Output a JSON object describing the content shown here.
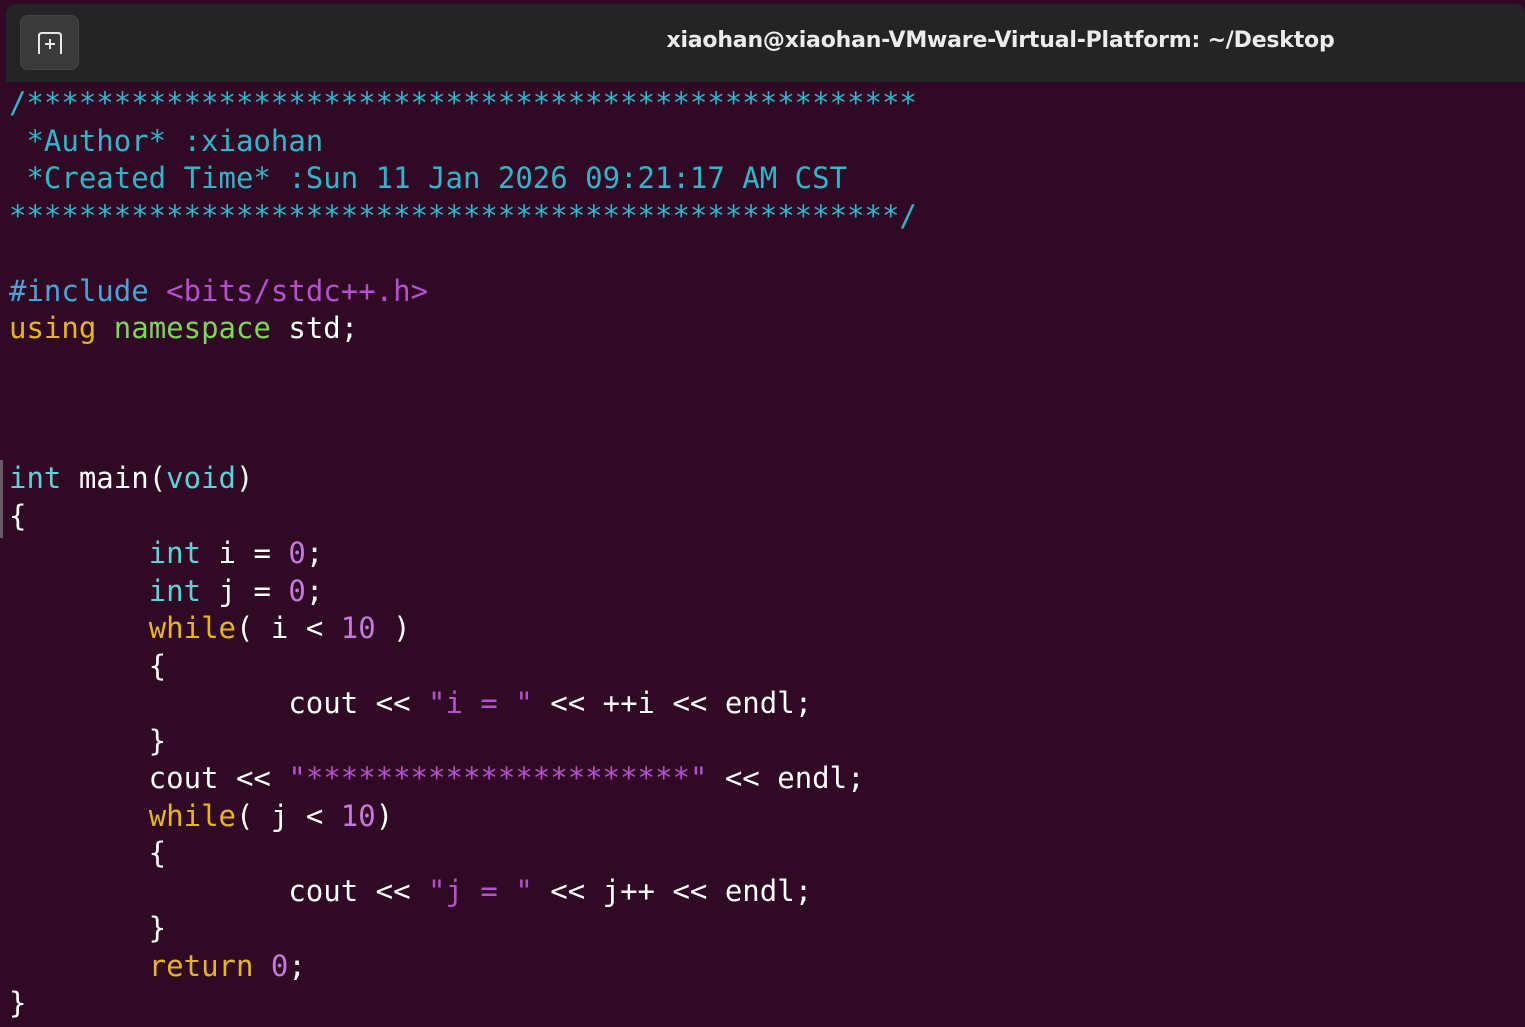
{
  "window": {
    "title": "xiaohan@xiaohan-VMware-Virtual-Platform: ~/Desktop"
  },
  "titlebar": {
    "new_tab_icon": "new-tab-icon"
  },
  "colors": {
    "background": "#300a24",
    "titlebar": "#242424",
    "comment": "#34b4c9",
    "preprocessor": "#4aa3d8",
    "string": "#b64fd1",
    "keyword": "#e5b522",
    "namespace": "#7fd45c",
    "type": "#5cd2d6",
    "number": "#c678dd",
    "text": "#ffffff"
  },
  "code_lines": [
    [
      {
        "t": "/***************************************************",
        "c": "comment"
      }
    ],
    [
      {
        "t": " *Author* :xiaohan",
        "c": "comment"
      }
    ],
    [
      {
        "t": " *Created Time* :Sun 11 Jan 2026 09:21:17 AM CST",
        "c": "comment"
      }
    ],
    [
      {
        "t": "***************************************************/",
        "c": "comment"
      }
    ],
    [],
    [
      {
        "t": "#include ",
        "c": "pre"
      },
      {
        "t": "<bits/stdc++.h>",
        "c": "str"
      }
    ],
    [
      {
        "t": "using",
        "c": "kw"
      },
      {
        "t": " ",
        "c": "plain"
      },
      {
        "t": "namespace",
        "c": "green"
      },
      {
        "t": " std;",
        "c": "plain"
      }
    ],
    [],
    [],
    [],
    [
      {
        "t": "int",
        "c": "type"
      },
      {
        "t": " main(",
        "c": "plain"
      },
      {
        "t": "void",
        "c": "type"
      },
      {
        "t": ")",
        "c": "plain"
      }
    ],
    [
      {
        "t": "{",
        "c": "plain"
      }
    ],
    [
      {
        "t": "        ",
        "c": "plain"
      },
      {
        "t": "int",
        "c": "type"
      },
      {
        "t": " i = ",
        "c": "plain"
      },
      {
        "t": "0",
        "c": "num"
      },
      {
        "t": ";",
        "c": "plain"
      }
    ],
    [
      {
        "t": "        ",
        "c": "plain"
      },
      {
        "t": "int",
        "c": "type"
      },
      {
        "t": " j = ",
        "c": "plain"
      },
      {
        "t": "0",
        "c": "num"
      },
      {
        "t": ";",
        "c": "plain"
      }
    ],
    [
      {
        "t": "        ",
        "c": "plain"
      },
      {
        "t": "while",
        "c": "kw"
      },
      {
        "t": "( i < ",
        "c": "plain"
      },
      {
        "t": "10",
        "c": "num"
      },
      {
        "t": " )",
        "c": "plain"
      }
    ],
    [
      {
        "t": "        {",
        "c": "plain"
      }
    ],
    [
      {
        "t": "                cout << ",
        "c": "plain"
      },
      {
        "t": "\"i = \"",
        "c": "str"
      },
      {
        "t": " << ++i << endl;",
        "c": "plain"
      }
    ],
    [
      {
        "t": "        }",
        "c": "plain"
      }
    ],
    [
      {
        "t": "        cout << ",
        "c": "plain"
      },
      {
        "t": "\"**********************\"",
        "c": "str"
      },
      {
        "t": " << endl;",
        "c": "plain"
      }
    ],
    [
      {
        "t": "        ",
        "c": "plain"
      },
      {
        "t": "while",
        "c": "kw"
      },
      {
        "t": "( j < ",
        "c": "plain"
      },
      {
        "t": "10",
        "c": "num"
      },
      {
        "t": ")",
        "c": "plain"
      }
    ],
    [
      {
        "t": "        {",
        "c": "plain"
      }
    ],
    [
      {
        "t": "                cout << ",
        "c": "plain"
      },
      {
        "t": "\"j = \"",
        "c": "str"
      },
      {
        "t": " << j++ << endl;",
        "c": "plain"
      }
    ],
    [
      {
        "t": "        }",
        "c": "plain"
      }
    ],
    [
      {
        "t": "        ",
        "c": "plain"
      },
      {
        "t": "return",
        "c": "kw"
      },
      {
        "t": " ",
        "c": "plain"
      },
      {
        "t": "0",
        "c": "num"
      },
      {
        "t": ";",
        "c": "plain"
      }
    ],
    [
      {
        "t": "}",
        "c": "plain"
      }
    ]
  ]
}
